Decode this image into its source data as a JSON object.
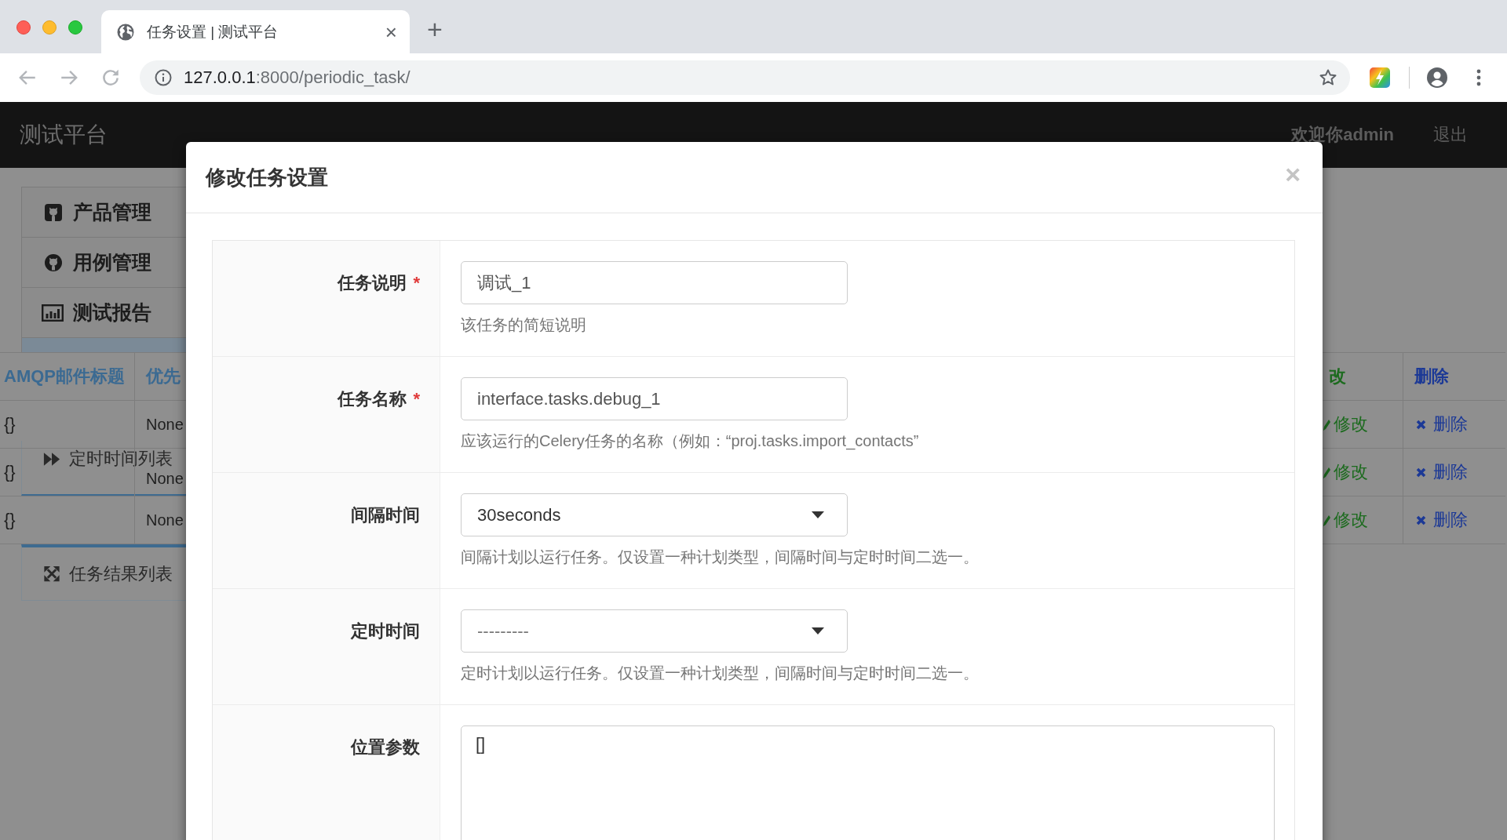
{
  "browser": {
    "tab_title": "任务设置 | 测试平台",
    "tab_close": "×",
    "new_tab": "+",
    "url_host": "127.0.0.1",
    "url_path": ":8000/periodic_task/"
  },
  "navbar": {
    "brand": "测试平台",
    "welcome": "欢迎你admin",
    "logout": "退出"
  },
  "sidebar": {
    "items": [
      "产品管理",
      "用例管理",
      "测试报告"
    ],
    "sub_items": [
      "定时时间列表",
      "任务结果列表"
    ]
  },
  "table": {
    "columns": [
      "AMQP邮件标题",
      "优先",
      "改",
      "删除"
    ],
    "rows": [
      [
        "{}",
        "None",
        "修改",
        "删除"
      ],
      [
        "{}",
        "None",
        "修改",
        "删除"
      ],
      [
        "{}",
        "None",
        "修改",
        "删除"
      ]
    ]
  },
  "modal": {
    "title": "修改任务设置",
    "close": "×",
    "fields": [
      {
        "label": "任务说明",
        "required_mark": "*",
        "kind": "text",
        "value": "调试_1",
        "help": "该任务的简短说明"
      },
      {
        "label": "任务名称",
        "required_mark": "*",
        "kind": "text",
        "value": "interface.tasks.debug_1",
        "help": "应该运行的Celery任务的名称（例如：“proj.tasks.import_contacts”"
      },
      {
        "label": "间隔时间",
        "kind": "select",
        "value": "30seconds",
        "help": "间隔计划以运行任务。仅设置一种计划类型，间隔时间与定时时间二选一。"
      },
      {
        "label": "定时时间",
        "kind": "select",
        "placeholder": "---------",
        "help": "定时计划以运行任务。仅设置一种计划类型，间隔时间与定时时间二选一。"
      },
      {
        "label": "位置参数",
        "kind": "textarea",
        "value": "[]"
      }
    ]
  }
}
